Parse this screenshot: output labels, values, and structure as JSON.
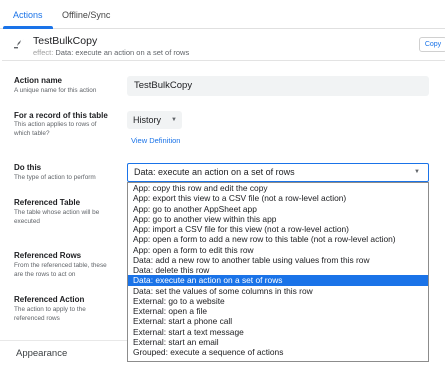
{
  "tabs": [
    {
      "label": "Actions",
      "active": true
    },
    {
      "label": "Offline/Sync",
      "active": false
    }
  ],
  "header": {
    "title": "TestBulkCopy",
    "subtitle_prefix": "effect:",
    "subtitle": "Data: execute an action on a set of rows",
    "copy_label": "Copy",
    "icon": "action-bolt-icon"
  },
  "form": {
    "action_name": {
      "label": "Action name",
      "desc": "A unique name for this action",
      "value": "TestBulkCopy"
    },
    "table": {
      "label": "For a record of this table",
      "desc": "This action applies to rows of which table?",
      "value": "History",
      "link": "View Definition"
    },
    "do_this": {
      "label": "Do this",
      "desc": "The type of action to perform",
      "value": "Data: execute an action on a set of rows"
    },
    "ref_table": {
      "label": "Referenced Table",
      "desc": "The table whose action will be executed"
    },
    "ref_rows": {
      "label": "Referenced Rows",
      "desc": "From the referenced table, these are the rows to act on"
    },
    "ref_action": {
      "label": "Referenced Action",
      "desc": "The action to apply to the referenced rows"
    }
  },
  "dropdown": {
    "selected_index": 9,
    "options": [
      "App: copy this row and edit the copy",
      "App: export this view to a CSV file (not a row-level action)",
      "App: go to another AppSheet app",
      "App: go to another view within this app",
      "App: import a CSV file for this view (not a row-level action)",
      "App: open a form to add a new row to this table (not a row-level action)",
      "App: open a form to edit this row",
      "Data: add a new row to another table using values from this row",
      "Data: delete this row",
      "Data: execute an action on a set of rows",
      "Data: set the values of some columns in this row",
      "External: go to a website",
      "External: open a file",
      "External: start a phone call",
      "External: start a text message",
      "External: start an email",
      "Grouped: execute a sequence of actions"
    ]
  },
  "section": {
    "appearance": "Appearance"
  },
  "colors": {
    "accent": "#1a73e8",
    "field_bg": "#f1f3f4"
  }
}
